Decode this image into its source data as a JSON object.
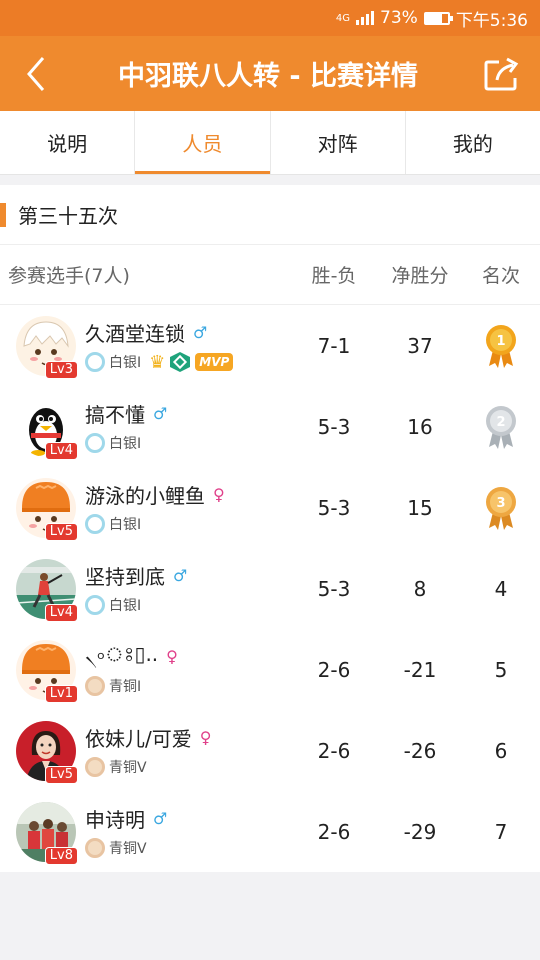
{
  "status_bar": {
    "network": "4G",
    "battery": "73%",
    "time": "下午5:36"
  },
  "header": {
    "title": "中羽联八人转 - 比赛详情"
  },
  "tabs": [
    {
      "label": "说明",
      "active": false
    },
    {
      "label": "人员",
      "active": true
    },
    {
      "label": "对阵",
      "active": false
    },
    {
      "label": "我的",
      "active": false
    }
  ],
  "round": {
    "title": "第三十五次"
  },
  "table": {
    "headers": {
      "players": "参赛选手(7人)",
      "win_loss": "胜-负",
      "net": "净胜分",
      "rank": "名次"
    },
    "rows": [
      {
        "name": "久酒堂连锁",
        "gender": "♂",
        "gender_type": "m",
        "level": "Lv3",
        "tier": "白银I",
        "tier_type": "silver",
        "badges": [
          "crown",
          "diamond",
          "MVP"
        ],
        "mvp_label": "MVP",
        "win_loss": "7-1",
        "net": "37",
        "rank": "1",
        "medal": "gold",
        "avatar": "cartoon-boy"
      },
      {
        "name": "搞不懂",
        "gender": "♂",
        "gender_type": "m",
        "level": "Lv4",
        "tier": "白银I",
        "tier_type": "silver",
        "win_loss": "5-3",
        "net": "16",
        "rank": "2",
        "medal": "silver",
        "avatar": "penguin"
      },
      {
        "name": "游泳的小鲤鱼",
        "gender": "♀",
        "gender_type": "f",
        "level": "Lv5",
        "tier": "白银I",
        "tier_type": "silver",
        "win_loss": "5-3",
        "net": "15",
        "rank": "3",
        "medal": "bronze",
        "avatar": "cartoon-orange-hat"
      },
      {
        "name": "坚持到底",
        "gender": "♂",
        "gender_type": "m",
        "level": "Lv4",
        "tier": "白银I",
        "tier_type": "silver",
        "win_loss": "5-3",
        "net": "8",
        "rank": "4",
        "avatar": "photo-court"
      },
      {
        "name": "৲৹ঃ▯..",
        "gender": "♀",
        "gender_type": "f",
        "level": "Lv1",
        "tier": "青铜I",
        "tier_type": "bronze",
        "win_loss": "2-6",
        "net": "-21",
        "rank": "5",
        "avatar": "cartoon-orange-hat"
      },
      {
        "name": "依妹儿/可爱",
        "gender": "♀",
        "gender_type": "f",
        "level": "Lv5",
        "tier": "青铜V",
        "tier_type": "bronze",
        "win_loss": "2-6",
        "net": "-26",
        "rank": "6",
        "avatar": "photo-woman"
      },
      {
        "name": "申诗明",
        "gender": "♂",
        "gender_type": "m",
        "level": "Lv8",
        "tier": "青铜V",
        "tier_type": "bronze",
        "win_loss": "2-6",
        "net": "-29",
        "rank": "7",
        "avatar": "photo-group"
      }
    ]
  },
  "colors": {
    "accent": "#ef8a2e",
    "level_badge": "#e3392f",
    "male": "#3aa7e0",
    "female": "#e0408a"
  }
}
